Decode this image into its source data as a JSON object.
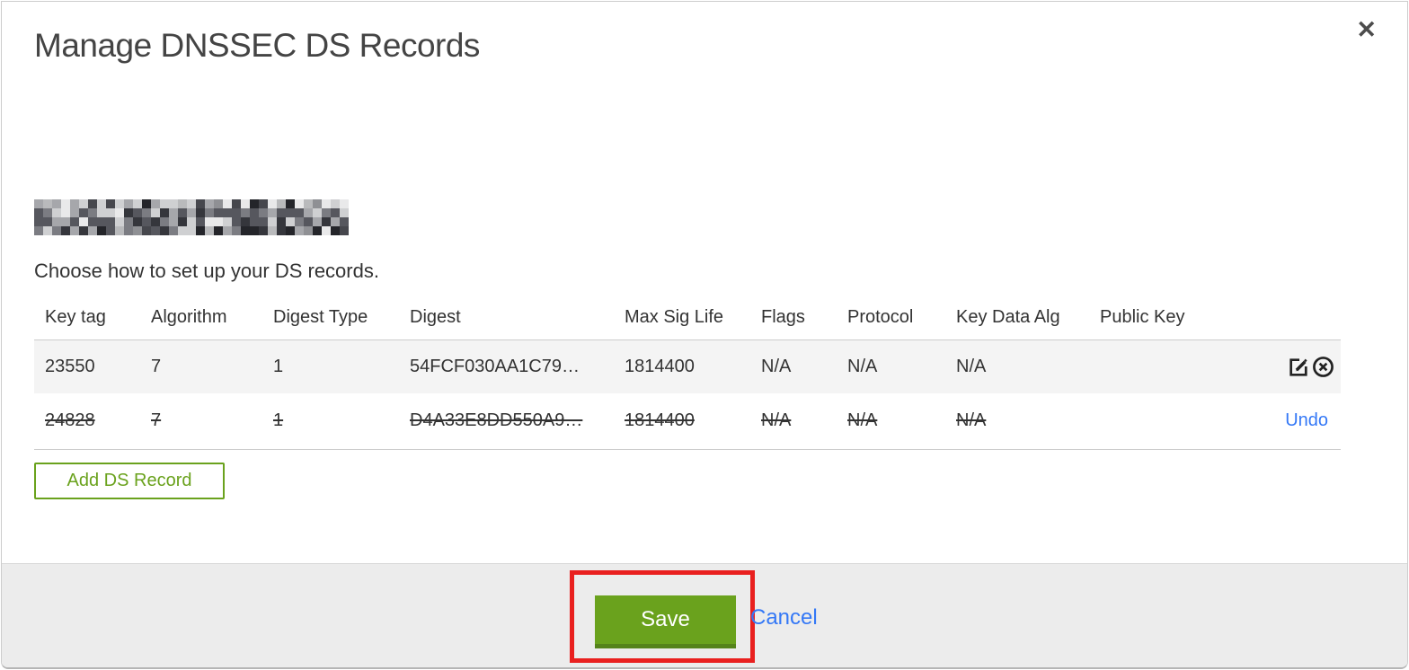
{
  "modal": {
    "title": "Manage DNSSEC DS Records",
    "close_glyph": "✕",
    "instruction": "Choose how to set up your DS records."
  },
  "table": {
    "columns": [
      "Key tag",
      "Algorithm",
      "Digest Type",
      "Digest",
      "Max Sig Life",
      "Flags",
      "Protocol",
      "Key Data Alg",
      "Public Key"
    ],
    "rows": [
      {
        "cells": [
          "23550",
          "7",
          "1",
          "54FCF030AA1C79…",
          "1814400",
          "N/A",
          "N/A",
          "N/A",
          ""
        ],
        "deleted": false,
        "actions": [
          "edit",
          "delete"
        ]
      },
      {
        "cells": [
          "24828",
          "7",
          "1",
          "D4A33E8DD550A9…",
          "1814400",
          "N/A",
          "N/A",
          "N/A",
          ""
        ],
        "deleted": true,
        "action_label": "Undo"
      }
    ]
  },
  "buttons": {
    "add_ds_record": "Add DS Record",
    "save": "Save",
    "cancel": "Cancel"
  },
  "colors": {
    "accent_green": "#6aa21d",
    "accent_green_dark": "#55831a",
    "link_blue": "#3478f6",
    "annotation_red": "#e9201f",
    "row_highlight": "#f4f4f4",
    "footer_gray": "#ececec"
  },
  "redaction": {
    "palette": [
      "#35363c",
      "#56575e",
      "#7b7c82",
      "#a6a7ab",
      "#cfd0d2",
      "#e9e9ea",
      "#46474d",
      "#8f9094",
      "#24252a",
      "#b9babc"
    ]
  }
}
